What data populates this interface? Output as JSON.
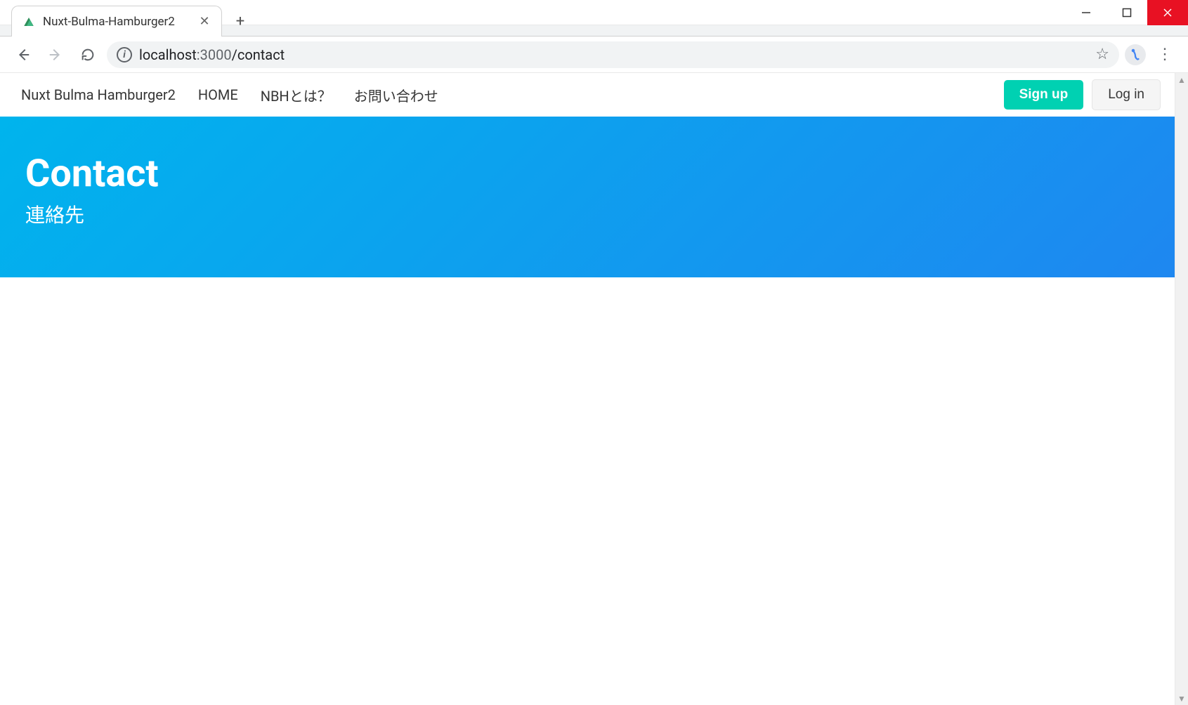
{
  "window": {
    "minimize": "—",
    "maximize": "▢",
    "close": "✕"
  },
  "browser": {
    "tab": {
      "title": "Nuxt-Bulma-Hamburger2",
      "close": "✕"
    },
    "new_tab": "+",
    "url": {
      "host": "localhost",
      "port": ":3000",
      "path": "/contact"
    }
  },
  "site": {
    "brand": "Nuxt Bulma Hamburger2",
    "nav": [
      {
        "label": "HOME"
      },
      {
        "label": "NBHとは？"
      },
      {
        "label": "お問い合わせ"
      }
    ],
    "actions": {
      "signup": "Sign up",
      "login": "Log in"
    }
  },
  "hero": {
    "title": "Contact",
    "subtitle": "連絡先"
  }
}
